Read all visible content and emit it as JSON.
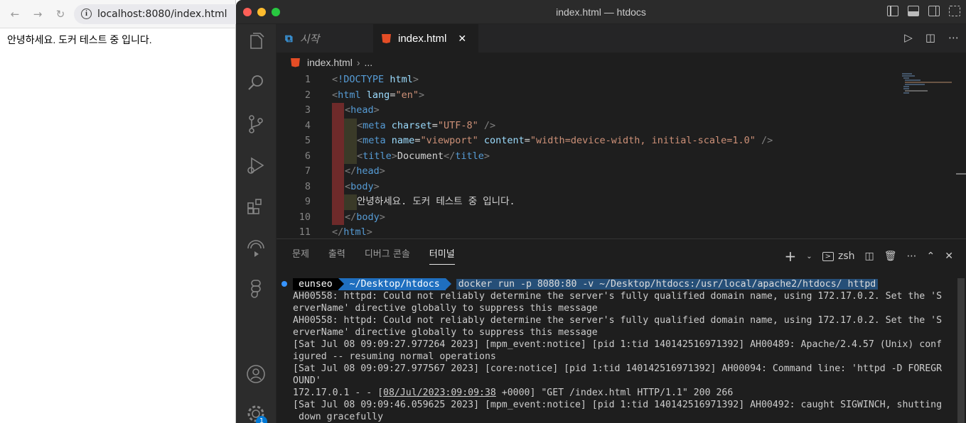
{
  "browser": {
    "url": "localhost:8080/index.html",
    "page_text": "안녕하세요. 도커 테스트 중 입니다."
  },
  "vscode": {
    "window_title": "index.html — htdocs",
    "tabs": [
      {
        "label": "시작",
        "icon": "vscode-logo-icon"
      },
      {
        "label": "index.html",
        "icon": "html5-icon",
        "active": true
      }
    ],
    "breadcrumb": {
      "file": "index.html",
      "rest": "..."
    },
    "code_lines": [
      {
        "n": "1"
      },
      {
        "n": "2"
      },
      {
        "n": "3"
      },
      {
        "n": "4"
      },
      {
        "n": "5"
      },
      {
        "n": "6"
      },
      {
        "n": "7"
      },
      {
        "n": "8"
      },
      {
        "n": "9"
      },
      {
        "n": "10"
      },
      {
        "n": "11"
      }
    ],
    "code": {
      "l1_doctype": "<!DOCTYPE",
      "l1_html": "html",
      "l2_lang_val": "\"en\"",
      "l4_charset_val": "\"UTF-8\"",
      "l5_name_val": "\"viewport\"",
      "l5_content_val": "\"width=device-width, initial-scale=1.0\"",
      "l6_title_text": "Document",
      "l9_text": "안녕하세요. 도커 테스트 중 입니다."
    },
    "panel_tabs": [
      "문제",
      "출력",
      "디버그 콘솔",
      "터미널"
    ],
    "terminal_shell": "zsh",
    "terminal": {
      "prompt_user": "eunseo",
      "prompt_dir": "~/Desktop/htdocs",
      "command": "docker run -p 8080:80 -v ~/Desktop/htdocs:/usr/local/apache2/htdocs/ httpd",
      "lines": [
        "AH00558: httpd: Could not reliably determine the server's fully qualified domain name, using 172.17.0.2. Set the 'S",
        "erverName' directive globally to suppress this message",
        "AH00558: httpd: Could not reliably determine the server's fully qualified domain name, using 172.17.0.2. Set the 'S",
        "erverName' directive globally to suppress this message",
        "[Sat Jul 08 09:09:27.977264 2023] [mpm_event:notice] [pid 1:tid 140142516971392] AH00489: Apache/2.4.57 (Unix) conf",
        "igured -- resuming normal operations",
        "[Sat Jul 08 09:09:27.977567 2023] [core:notice] [pid 1:tid 140142516971392] AH00094: Command line: 'httpd -D FOREGR",
        "OUND'"
      ],
      "access_prefix": "172.17.0.1 - - [",
      "access_date": "08/Jul/2023:09:09:38",
      "access_suffix": " +0000] \"GET /index.html HTTP/1.1\" 200 266",
      "lines2": [
        "[Sat Jul 08 09:09:46.059625 2023] [mpm_event:notice] [pid 1:tid 140142516971392] AH00492: caught SIGWINCH, shutting",
        " down gracefully"
      ]
    },
    "accounts_badge": "1"
  }
}
